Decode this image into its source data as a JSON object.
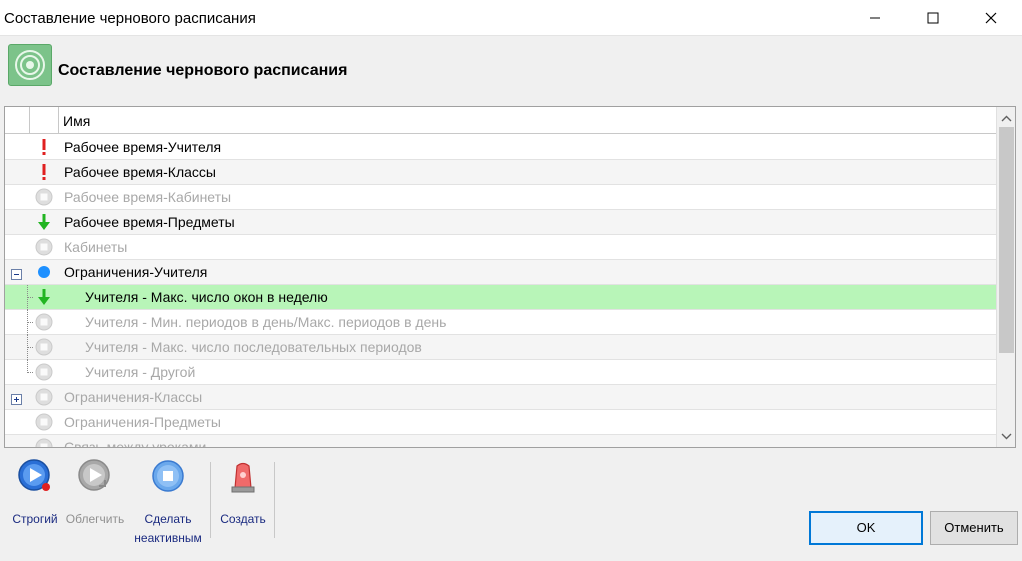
{
  "window": {
    "title": "Составление чернового расписания"
  },
  "header": {
    "title": "Составление чернового расписания"
  },
  "grid": {
    "column_name": "Имя",
    "rows": [
      {
        "label": "Рабочее время-Учителя",
        "icon": "exclamation-icon",
        "state": "error"
      },
      {
        "label": "Рабочее время-Классы",
        "icon": "exclamation-icon",
        "state": "error"
      },
      {
        "label": "Рабочее время-Кабинеты",
        "icon": "inactive-stop-icon",
        "state": "inactive"
      },
      {
        "label": "Рабочее время-Предметы",
        "icon": "green-down-arrow-icon",
        "state": "lighten"
      },
      {
        "label": "Кабинеты",
        "icon": "inactive-stop-icon",
        "state": "inactive"
      },
      {
        "label": "Ограничения-Учителя",
        "icon": "blue-dot-icon",
        "state": "mixed",
        "expander": "collapse"
      },
      {
        "label": "Учителя - Макс. число окон в неделю",
        "icon": "green-down-arrow-icon",
        "state": "lighten",
        "selected": true
      },
      {
        "label": "Учителя - Мин. периодов в день/Макс. периодов в день",
        "icon": "inactive-stop-icon",
        "state": "inactive"
      },
      {
        "label": "Учителя - Макс. число последовательных периодов",
        "icon": "inactive-stop-icon",
        "state": "inactive"
      },
      {
        "label": "Учителя - Другой",
        "icon": "inactive-stop-icon",
        "state": "inactive"
      },
      {
        "label": "Ограничения-Классы",
        "icon": "inactive-stop-icon",
        "state": "inactive",
        "expander": "expand"
      },
      {
        "label": "Ограничения-Предметы",
        "icon": "inactive-stop-icon",
        "state": "inactive"
      },
      {
        "label": "Связь между уроками",
        "icon": "inactive-stop-icon",
        "state": "inactive"
      }
    ]
  },
  "toolbar": {
    "strict_label": "Строгий",
    "lighten_label": "Облегчить",
    "make_inactive_label_1": "Сделать",
    "make_inactive_label_2": "неактивным",
    "create_label": "Создать"
  },
  "buttons": {
    "ok_label": "OK",
    "cancel_label": "Отменить"
  },
  "colors": {
    "selected_row": "#b8f5b8",
    "error": "#e02020",
    "arrow_green": "#22b522",
    "blue_dot": "#1e90ff",
    "disabled_text": "#a8a8a8",
    "toolbar_text": "#1a2a80"
  }
}
